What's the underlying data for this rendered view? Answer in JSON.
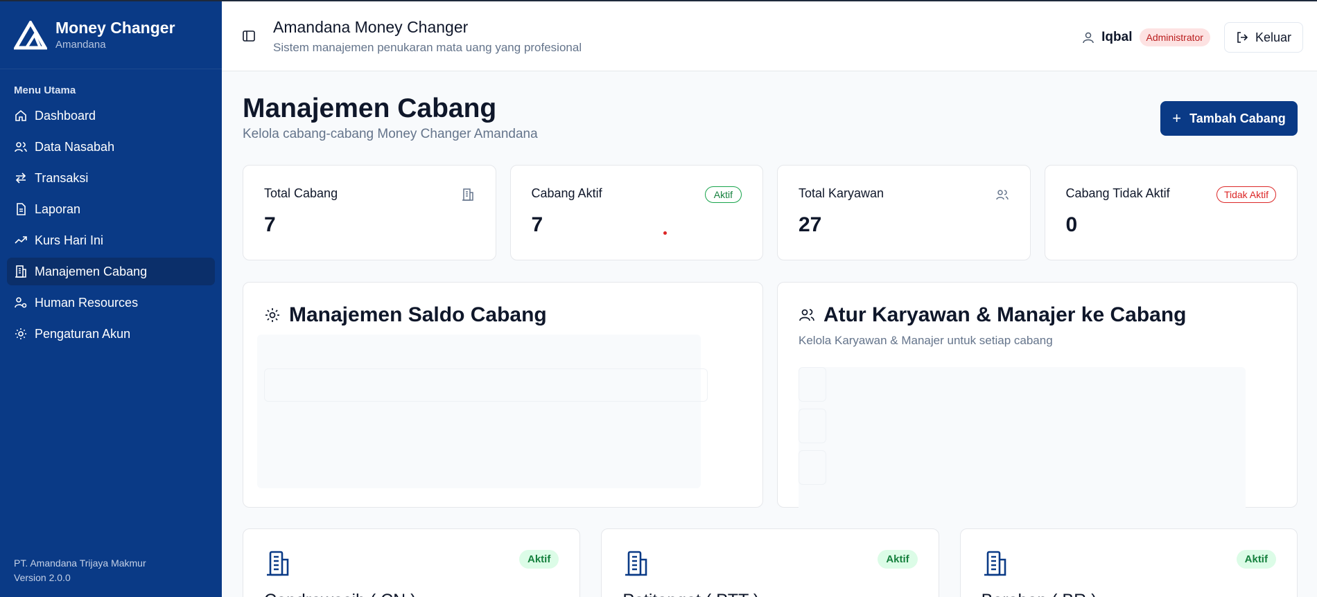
{
  "brand": {
    "title": "Money Changer",
    "subtitle": "Amandana"
  },
  "sidebar": {
    "section_label": "Menu Utama",
    "items": [
      {
        "label": "Dashboard",
        "icon": "home-icon"
      },
      {
        "label": "Data Nasabah",
        "icon": "users-icon"
      },
      {
        "label": "Transaksi",
        "icon": "arrows-icon"
      },
      {
        "label": "Laporan",
        "icon": "file-icon"
      },
      {
        "label": "Kurs Hari Ini",
        "icon": "trending-up-icon"
      },
      {
        "label": "Manajemen Cabang",
        "icon": "building-icon",
        "active": true
      },
      {
        "label": "Human Resources",
        "icon": "user-cog-icon"
      },
      {
        "label": "Pengaturan Akun",
        "icon": "gear-icon"
      }
    ],
    "footer_company": "PT. Amandana Trijaya Makmur",
    "footer_version": "Version 2.0.0"
  },
  "header": {
    "title": "Amandana Money Changer",
    "subtitle": "Sistem manajemen penukaran mata uang yang profesional",
    "user_name": "Iqbal",
    "role": "Administrator",
    "logout_label": "Keluar"
  },
  "page": {
    "title": "Manajemen Cabang",
    "subtitle": "Kelola cabang-cabang Money Changer Amandana",
    "add_label": "Tambah Cabang"
  },
  "stats": [
    {
      "label": "Total Cabang",
      "value": "7"
    },
    {
      "label": "Cabang Aktif",
      "value": "7",
      "badge": "Aktif"
    },
    {
      "label": "Total Karyawan",
      "value": "27"
    },
    {
      "label": "Cabang Tidak Aktif",
      "value": "0",
      "badge": "Tidak Aktif"
    }
  ],
  "panels": {
    "saldo_title": "Manajemen Saldo Cabang",
    "karyawan_title": "Atur Karyawan & Manajer ke Cabang",
    "karyawan_subtitle": "Kelola Karyawan & Manajer untuk setiap cabang"
  },
  "branches": [
    {
      "name": "Cendrawasih ( CN )",
      "status": "Aktif"
    },
    {
      "name": "Petitenget ( PTT )",
      "status": "Aktif"
    },
    {
      "name": "Beraban ( BR )",
      "status": "Aktif"
    }
  ],
  "colors": {
    "primary": "#0a3a86",
    "active_nav": "#0b2f6a",
    "success": "#15803d",
    "danger": "#dc2626"
  }
}
